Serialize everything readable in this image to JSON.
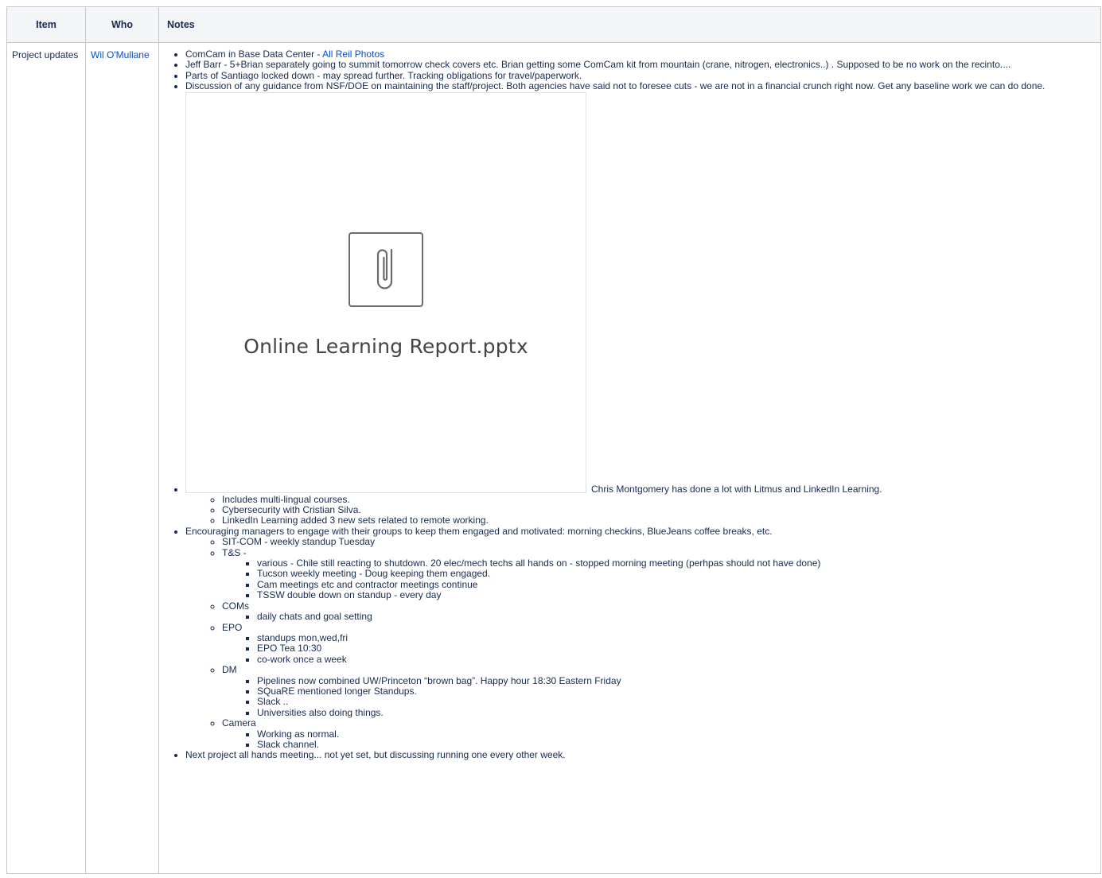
{
  "table": {
    "headers": {
      "item": "Item",
      "who": "Who",
      "notes": "Notes"
    },
    "row": {
      "item": "Project updates",
      "who": "Wil O'Mullane",
      "notes": {
        "comcam": {
          "text": "ComCam in Base Data Center - ",
          "link": "All Reil Photos"
        },
        "jeff": "Jeff Barr - 5+Brian separately going to summit tomorrow check covers etc. Brian getting some ComCam kit from mountain (crane, nitrogen, electronics..) . Supposed to be no work on the recinto....",
        "santiago": "Parts of Santiago locked down - may spread further. Tracking obligations for travel/paperwork.",
        "guidance": "Discussion of any guidance from NSF/DOE on maintaining the staff/project. Both agencies have said not to foresee cuts - we are not in a financial crunch right now. Get any baseline work we can do done.",
        "attachment": {
          "filename": "Online Learning Report.pptx",
          "icon": "paperclip-icon",
          "caption": "Chris Montgomery has done a lot with Litmus and LinkedIn Learning.",
          "sub": [
            "Includes multi-lingual courses.",
            "Cybersecurity with Cristian Silva.",
            "LinkedIn Learning added  3 new sets related to remote working."
          ]
        },
        "managers": {
          "text": "Encouraging managers to engage with their groups to keep them engaged and motivated: morning checkins, BlueJeans coffee breaks, etc.",
          "sitcom": "SIT-COM - weekly standup Tuesday",
          "ts": {
            "label": "T&S -",
            "items": [
              "various - Chile still reacting to shutdown. 20 elec/mech techs all hands on - stopped morning meeting (perhpas should not have done)",
              "Tucson weekly meeting - Doug keeping them engaged.",
              "Cam meetings etc and contractor meetings continue",
              "TSSW double down on standup - every day"
            ]
          },
          "coms": {
            "label": "COMs",
            "items": [
              "daily chats and goal setting"
            ]
          },
          "epo": {
            "label": "EPO",
            "items": [
              "standups mon,wed,fri",
              "EPO Tea 10:30",
              "co-work once a week"
            ]
          },
          "dm": {
            "label": "DM",
            "items": [
              "Pipelines now combined UW/Princeton “brown bag”. Happy hour 18:30 Eastern Friday",
              "SQuaRE mentioned longer Standups.",
              "Slack ..",
              "Universities also doing things."
            ]
          },
          "camera": {
            "label": "Camera",
            "items": [
              "Working as normal.",
              "Slack channel."
            ]
          }
        },
        "next": "Next project all hands meeting... not yet set, but discussing running one every other week."
      }
    }
  }
}
